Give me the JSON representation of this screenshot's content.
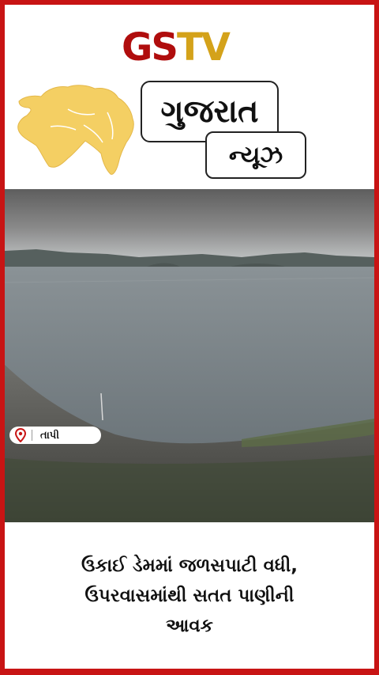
{
  "brand": {
    "logo_part1": "GS",
    "logo_part2": "TV"
  },
  "header": {
    "title": "ગુજરાત",
    "subtitle": "ન્યૂઝ"
  },
  "location": {
    "label": "તાપી",
    "icon": "location-pin-icon"
  },
  "headline": {
    "line1": "ઉકાઈ ડેમમાં જળસપાટી વધી,",
    "line2": "ઉપરવાસમાંથી સતત પાણીની",
    "line3": "આવક"
  },
  "colors": {
    "border": "#c81414",
    "logo_red": "#b00d0d",
    "logo_gold": "#d4a21a",
    "map": "#f4cf63"
  }
}
